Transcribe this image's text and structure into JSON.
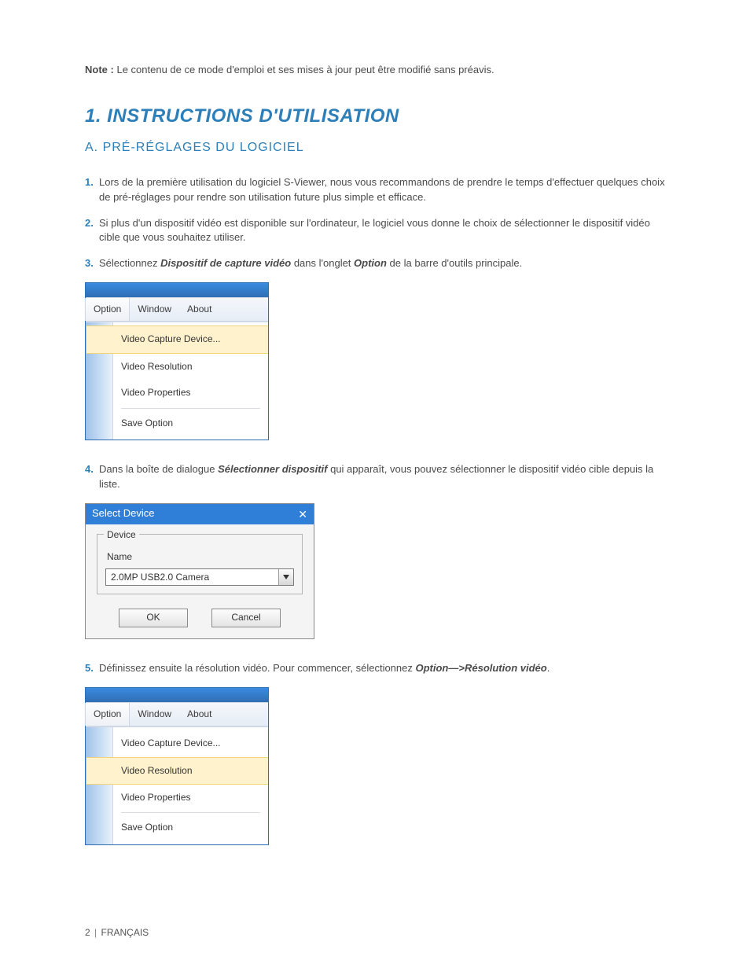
{
  "note": {
    "label": "Note :",
    "text": "Le contenu de ce mode d'emploi et ses mises à jour peut être modifié sans préavis."
  },
  "heading": "1. INSTRUCTIONS D'UTILISATION",
  "subheading": "A. PRÉ-RÉGLAGES DU LOGICIEL",
  "steps": {
    "s1": {
      "num": "1.",
      "text": "Lors de la première utilisation du logiciel S-Viewer, nous vous recommandons de prendre le temps d'effectuer quelques choix de pré-réglages pour rendre son utilisation future plus simple et efficace."
    },
    "s2": {
      "num": "2.",
      "text": "Si plus d'un dispositif vidéo est disponible sur l'ordinateur, le logiciel vous donne le choix de sélectionner le dispositif vidéo cible que vous souhaitez utiliser."
    },
    "s3": {
      "num": "3.",
      "pre": "Sélectionnez ",
      "bold1": "Dispositif de capture vidéo",
      "mid": " dans l'onglet ",
      "bold2": "Option",
      "post": " de la barre d'outils principale."
    },
    "s4": {
      "num": "4.",
      "pre": "Dans la boîte de dialogue ",
      "bold1": "Sélectionner dispositif",
      "post": " qui apparaît, vous pouvez sélectionner le dispositif vidéo cible depuis la liste."
    },
    "s5": {
      "num": "5.",
      "pre": "Définissez ensuite la résolution vidéo. Pour commencer, sélectionnez ",
      "bold1": "Option—>Résolution vidéo",
      "post": "."
    }
  },
  "menu": {
    "bar": {
      "option": "Option",
      "window": "Window",
      "about": "About"
    },
    "items": {
      "capture": "Video Capture Device...",
      "resolution": "Video Resolution",
      "properties": "Video Properties",
      "save": "Save Option"
    }
  },
  "dialog": {
    "title": "Select Device",
    "legend": "Device",
    "name_label": "Name",
    "combo_value": "2.0MP USB2.0 Camera",
    "ok": "OK",
    "cancel": "Cancel"
  },
  "footer": {
    "page": "2",
    "lang": "FRANÇAIS"
  }
}
